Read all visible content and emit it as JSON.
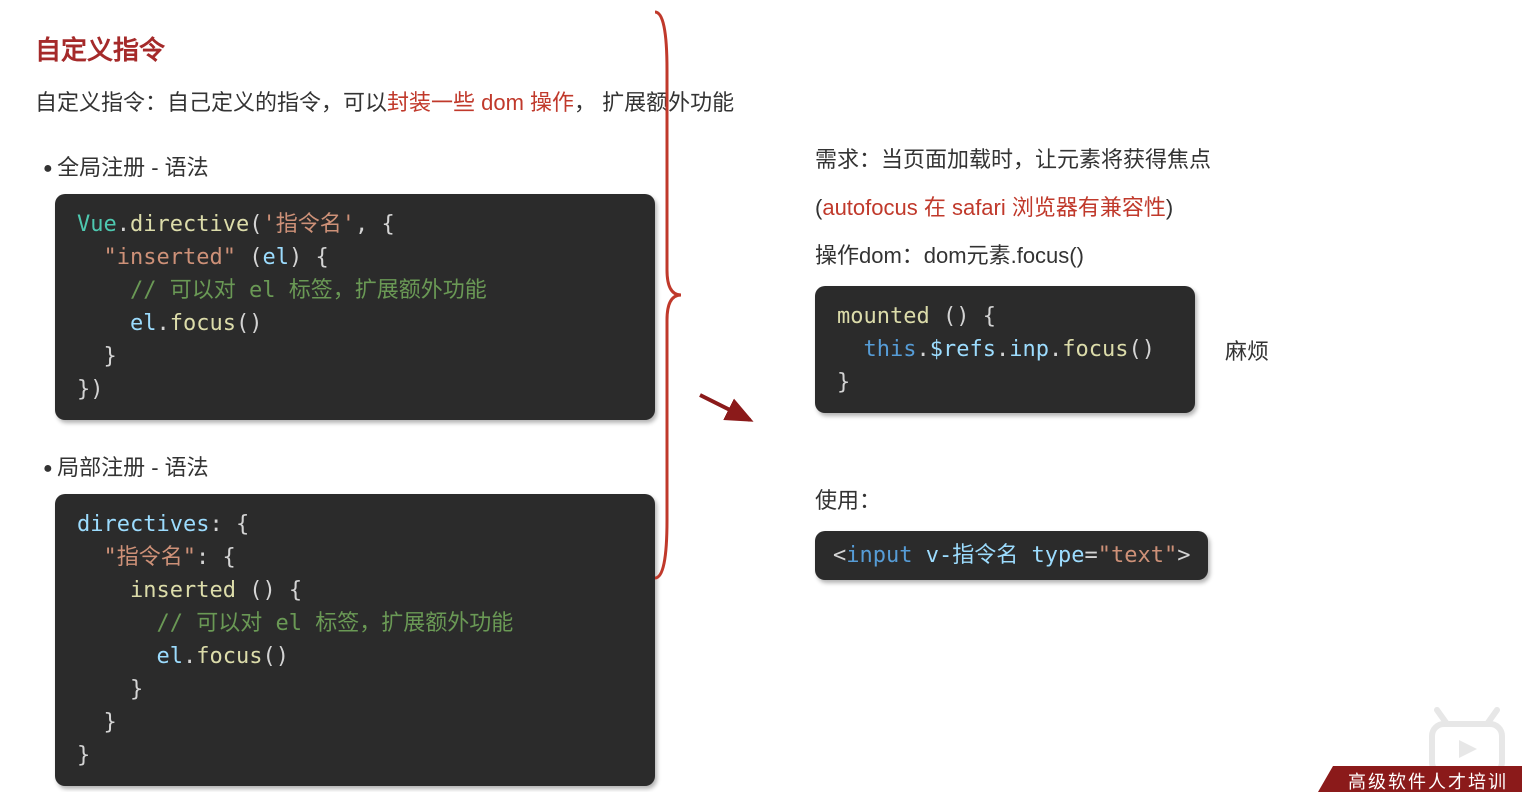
{
  "title": "自定义指令",
  "subtitle_plain1": "自定义指令：自己定义的指令，可以",
  "subtitle_em": "封装一些 dom 操作",
  "subtitle_plain2": "，  扩展额外功能",
  "bullet1": "全局注册 - 语法",
  "bullet2": "局部注册 - 语法",
  "code1": {
    "l1a": "Vue",
    "l1b": ".",
    "l1c": "directive",
    "l1d": "(",
    "l1e": "'指令名'",
    "l1f": ", {",
    "l2a": "  ",
    "l2b": "\"inserted\"",
    "l2c": " (",
    "l2d": "el",
    "l2e": ") {",
    "l3a": "    ",
    "l3b": "// 可以对 el 标签，扩展额外功能",
    "l4a": "    ",
    "l4b": "el",
    "l4c": ".",
    "l4d": "focus",
    "l4e": "()",
    "l5": "  }",
    "l6": "})"
  },
  "code2": {
    "l1a": "directives",
    "l1b": ": {",
    "l2a": "  ",
    "l2b": "\"指令名\"",
    "l2c": ": {",
    "l3a": "    ",
    "l3b": "inserted",
    "l3c": " () {",
    "l4a": "      ",
    "l4b": "// 可以对 el 标签，扩展额外功能",
    "l5a": "      ",
    "l5b": "el",
    "l5c": ".",
    "l5d": "focus",
    "l5e": "()",
    "l6": "    }",
    "l7": "  }",
    "l8": "}"
  },
  "right": {
    "req": "需求：当页面加载时，让元素将获得焦点",
    "compat_open": "(",
    "compat_em": "autofocus 在 safari 浏览器有兼容性",
    "compat_close": ")",
    "dom_op": "操作dom：dom元素.focus()",
    "annot": "麻烦",
    "usage_label": "使用："
  },
  "code3": {
    "l1a": "mounted",
    "l1b": " () {",
    "l2a": "  ",
    "l2b": "this",
    "l2c": ".",
    "l2d": "$refs",
    "l2e": ".",
    "l2f": "inp",
    "l2g": ".",
    "l2h": "focus",
    "l2i": "()",
    "l3": "}"
  },
  "code4": {
    "open": "<",
    "tag": "input",
    "sp1": " ",
    "attr1": "v-指令名",
    "sp2": " ",
    "attr2": "type",
    "eq": "=",
    "val": "\"text\"",
    "close": ">"
  },
  "footer": "高级软件人才培训"
}
